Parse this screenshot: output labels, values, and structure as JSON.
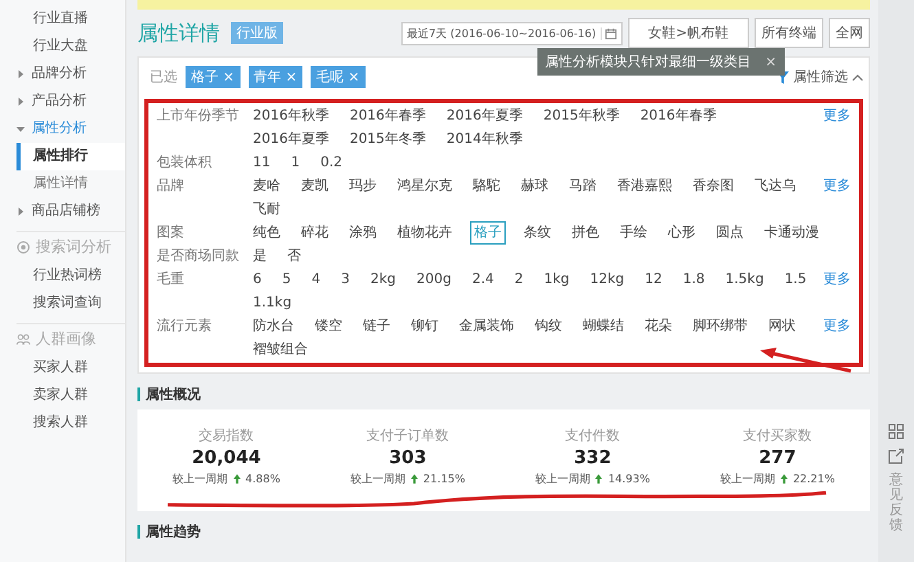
{
  "sidebar": {
    "items": [
      {
        "kind": "item",
        "label": "行业直播",
        "selected": false
      },
      {
        "kind": "item",
        "label": "行业大盘",
        "selected": false
      },
      {
        "kind": "group",
        "label": "品牌分析",
        "expanded": false,
        "selected": false
      },
      {
        "kind": "group",
        "label": "产品分析",
        "expanded": false,
        "selected": false
      },
      {
        "kind": "group",
        "label": "属性分析",
        "expanded": true,
        "selected": true
      },
      {
        "kind": "sub",
        "label": "属性排行",
        "selected": true
      },
      {
        "kind": "sub",
        "label": "属性详情",
        "selected": false
      },
      {
        "kind": "group",
        "label": "商品店铺榜",
        "expanded": false,
        "selected": false
      },
      {
        "kind": "section",
        "label": "搜索词分析",
        "selected": false
      },
      {
        "kind": "item",
        "label": "行业热词榜",
        "selected": false
      },
      {
        "kind": "item",
        "label": "搜索词查询",
        "selected": false
      },
      {
        "kind": "section",
        "label": "人群画像",
        "selected": false
      },
      {
        "kind": "item",
        "label": "买家人群",
        "selected": false
      },
      {
        "kind": "item",
        "label": "卖家人群",
        "selected": false
      },
      {
        "kind": "item",
        "label": "搜索人群",
        "selected": false
      }
    ]
  },
  "header": {
    "title": "属性详情",
    "badge": "行业版",
    "date_range": "最近7天 (2016-06-10~2016-06-16)",
    "category": "女鞋>帆布鞋",
    "terminal": "所有终端",
    "scope": "全网"
  },
  "tooltip": {
    "text": "属性分析模块只针对最细一级类目",
    "close": "×"
  },
  "selected_filters": {
    "label": "已选",
    "chips": [
      {
        "text": "格子",
        "remove": "×"
      },
      {
        "text": "青年",
        "remove": "×"
      },
      {
        "text": "毛呢",
        "remove": "×"
      }
    ],
    "toggle": "属性筛选",
    "expanded": true
  },
  "filter_rows": [
    {
      "label": "上市年份季节",
      "values": [
        {
          "text": "2016年秋季",
          "selected": false
        },
        {
          "text": "2016年春季",
          "selected": false
        },
        {
          "text": "2016年夏季",
          "selected": false
        },
        {
          "text": "2015年秋季",
          "selected": false
        },
        {
          "text": "2016年春季",
          "selected": false
        },
        {
          "text": "2016年夏季",
          "selected": false
        },
        {
          "text": "2015年冬季",
          "selected": false
        },
        {
          "text": "2014年秋季",
          "selected": false
        }
      ],
      "more": "更多"
    },
    {
      "label": "包装体积",
      "values": [
        {
          "text": "11",
          "selected": false
        },
        {
          "text": "1",
          "selected": false
        },
        {
          "text": "0.2",
          "selected": false
        }
      ]
    },
    {
      "label": "品牌",
      "values": [
        {
          "text": "麦哈",
          "selected": false
        },
        {
          "text": "麦凯",
          "selected": false
        },
        {
          "text": "玛步",
          "selected": false
        },
        {
          "text": "鸿星尔克",
          "selected": false
        },
        {
          "text": "駱駝",
          "selected": false
        },
        {
          "text": "赫球",
          "selected": false
        },
        {
          "text": "马踏",
          "selected": false
        },
        {
          "text": "香港嘉熙",
          "selected": false
        },
        {
          "text": "香奈图",
          "selected": false
        },
        {
          "text": "飞达乌",
          "selected": false
        },
        {
          "text": "飞耐",
          "selected": false
        }
      ],
      "more": "更多"
    },
    {
      "label": "图案",
      "values": [
        {
          "text": "纯色",
          "selected": false
        },
        {
          "text": "碎花",
          "selected": false
        },
        {
          "text": "涂鸦",
          "selected": false
        },
        {
          "text": "植物花卉",
          "selected": false
        },
        {
          "text": "格子",
          "selected": true
        },
        {
          "text": "条纹",
          "selected": false
        },
        {
          "text": "拼色",
          "selected": false
        },
        {
          "text": "手绘",
          "selected": false
        },
        {
          "text": "心形",
          "selected": false
        },
        {
          "text": "圆点",
          "selected": false
        },
        {
          "text": "卡通动漫",
          "selected": false
        }
      ]
    },
    {
      "label": "是否商场同款",
      "values": [
        {
          "text": "是",
          "selected": false
        },
        {
          "text": "否",
          "selected": false
        }
      ]
    },
    {
      "label": "毛重",
      "values": [
        {
          "text": "6",
          "selected": false
        },
        {
          "text": "5",
          "selected": false
        },
        {
          "text": "4",
          "selected": false
        },
        {
          "text": "3",
          "selected": false
        },
        {
          "text": "2kg",
          "selected": false
        },
        {
          "text": "200g",
          "selected": false
        },
        {
          "text": "2.4",
          "selected": false
        },
        {
          "text": "2",
          "selected": false
        },
        {
          "text": "1kg",
          "selected": false
        },
        {
          "text": "12kg",
          "selected": false
        },
        {
          "text": "12",
          "selected": false
        },
        {
          "text": "1.8",
          "selected": false
        },
        {
          "text": "1.5kg",
          "selected": false
        },
        {
          "text": "1.5",
          "selected": false
        },
        {
          "text": "1.1kg",
          "selected": false
        }
      ],
      "more": "更多"
    },
    {
      "label": "流行元素",
      "values": [
        {
          "text": "防水台",
          "selected": false
        },
        {
          "text": "镂空",
          "selected": false
        },
        {
          "text": "链子",
          "selected": false
        },
        {
          "text": "铆钉",
          "selected": false
        },
        {
          "text": "金属装饰",
          "selected": false
        },
        {
          "text": "钩纹",
          "selected": false
        },
        {
          "text": "蝴蝶结",
          "selected": false
        },
        {
          "text": "花朵",
          "selected": false
        },
        {
          "text": "脚环绑带",
          "selected": false
        },
        {
          "text": "网状",
          "selected": false
        },
        {
          "text": "褶皱组合",
          "selected": false
        }
      ],
      "more": "更多"
    }
  ],
  "overview": {
    "title": "属性概况",
    "metrics": [
      {
        "label": "交易指数",
        "value": "20,044",
        "compare_label": "较上一周期",
        "change": "4.88%"
      },
      {
        "label": "支付子订单数",
        "value": "303",
        "compare_label": "较上一周期",
        "change": "21.15%"
      },
      {
        "label": "支付件数",
        "value": "332",
        "compare_label": "较上一周期",
        "change": "14.93%"
      },
      {
        "label": "支付买家数",
        "value": "277",
        "compare_label": "较上一周期",
        "change": "22.21%"
      }
    ]
  },
  "trend": {
    "title": "属性趋势"
  },
  "side_tools": {
    "feedback": "意见反馈"
  }
}
